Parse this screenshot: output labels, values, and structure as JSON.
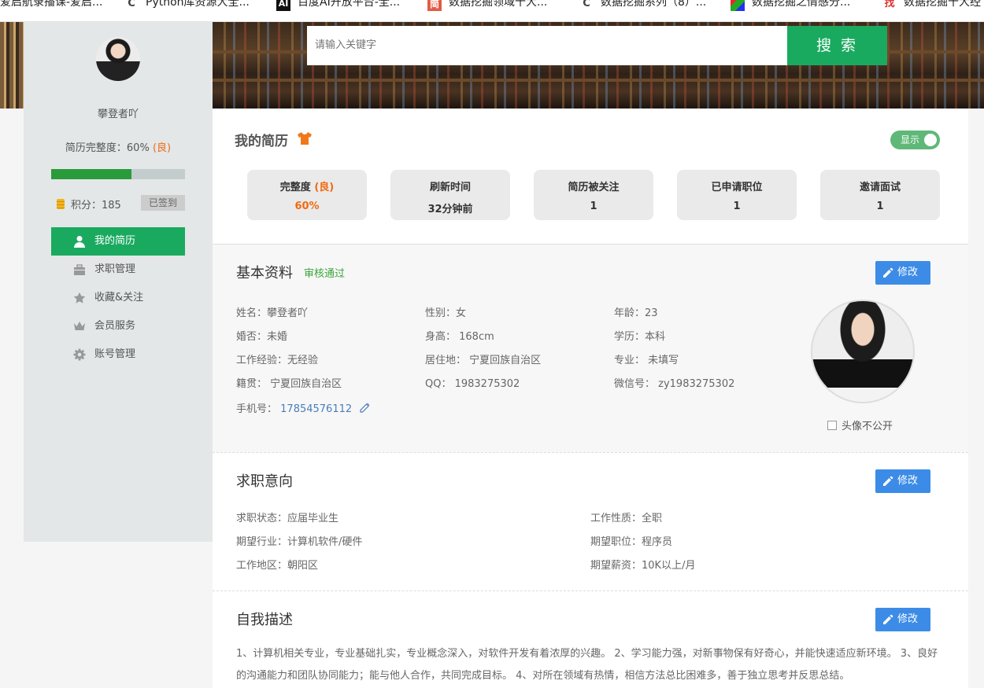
{
  "bookmarks": [
    {
      "label": "爱启航录播课-爱启...",
      "icon": "page-icon",
      "glyph": ""
    },
    {
      "label": "Python库资源大全...",
      "icon": "csdn-icon",
      "glyph": "Ϲ"
    },
    {
      "label": "百度AI开放平台-全...",
      "icon": "baidu-ai-icon",
      "glyph": "AI"
    },
    {
      "label": "数据挖掘领域十大...",
      "icon": "jianshu-icon",
      "glyph": "简"
    },
    {
      "label": "数据挖掘系列（8）...",
      "icon": "csdn-icon",
      "glyph": "Ϲ"
    },
    {
      "label": "数据挖掘之情感分...",
      "icon": "colorful-icon",
      "glyph": "■"
    },
    {
      "label": "数据挖掘十大经",
      "icon": "zhao-icon",
      "glyph": "找"
    }
  ],
  "search": {
    "placeholder": "请输入关键字",
    "button": "搜 索"
  },
  "sidebar": {
    "username": "攀登者吖",
    "completeness_label": "简历完整度：60% ",
    "completeness_level": "(良)",
    "completeness_value": 0.6,
    "points": "积分：185",
    "signed": "已签到",
    "menu": [
      {
        "label": "我的简历",
        "icon": "user-icon",
        "active": true
      },
      {
        "label": "求职管理",
        "icon": "briefcase-icon",
        "active": false
      },
      {
        "label": "收藏&关注",
        "icon": "star-icon",
        "active": false
      },
      {
        "label": "会员服务",
        "icon": "crown-icon",
        "active": false
      },
      {
        "label": "账号管理",
        "icon": "gear-icon",
        "active": false
      }
    ]
  },
  "resume": {
    "title": "我的简历",
    "toggle_label": "显示",
    "stats": [
      {
        "label": "完整度 ",
        "label_level": "(良)",
        "value": "60%"
      },
      {
        "label": "刷新时间",
        "label_level": "",
        "value": "32分钟前"
      },
      {
        "label": "简历被关注",
        "label_level": "",
        "value": "1"
      },
      {
        "label": "已申请职位",
        "label_level": "",
        "value": "1"
      },
      {
        "label": "邀请面试",
        "label_level": "",
        "value": "1"
      }
    ]
  },
  "basic": {
    "title": "基本资料",
    "status": "审核通过",
    "edit": "修改",
    "fields": [
      "姓名：攀登者吖",
      "性别：女",
      "年龄：23",
      "婚否：未婚",
      "身高： 168cm",
      "学历：本科",
      "工作经验：无经验",
      "居住地： 宁夏回族自治区",
      "专业： 未填写",
      "籍贯： 宁夏回族自治区",
      "QQ： 1983275302",
      "微信号： zy1983275302"
    ],
    "phone_label": "手机号：",
    "phone": "17854576112",
    "hide_avatar": "头像不公开"
  },
  "intent": {
    "title": "求职意向",
    "edit": "修改",
    "fields": [
      "求职状态：应届毕业生",
      "工作性质：全职",
      "期望行业：计算机软件/硬件",
      "期望职位：程序员",
      "工作地区：朝阳区",
      "期望薪资：10K以上/月"
    ]
  },
  "self": {
    "title": "自我描述",
    "edit": "修改",
    "text": "1、计算机相关专业，专业基础扎实，专业概念深入，对软件开发有着浓厚的兴趣。 2、学习能力强，对新事物保有好奇心，并能快速适应新环境。 3、良好的沟通能力和团队协同能力；能与他人合作，共同完成目标。 4、对所在领域有热情，相信方法总比困难多，善于独立思考并反思总结。"
  },
  "colors": {
    "green": "#1aaa5f",
    "orange": "#f06a12",
    "blue": "#3c8ce7",
    "audit_green": "#3aa53a"
  }
}
